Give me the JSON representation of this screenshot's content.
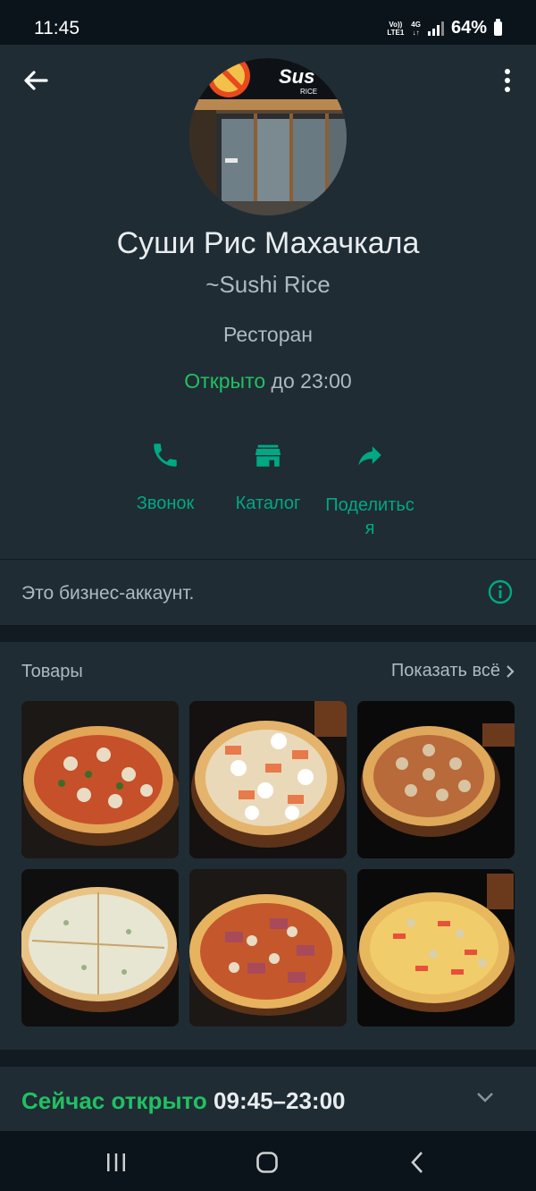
{
  "status_bar": {
    "time": "11:45",
    "volte": "Vo))",
    "lte": "LTE1",
    "net": "4G",
    "battery": "64%"
  },
  "profile": {
    "name": "Суши Рис Махачкала",
    "pushname": "~Sushi Rice",
    "category": "Ресторан",
    "open_label": "Открыто",
    "open_until": "до 23:00",
    "avatar_sign_text": "Sus",
    "avatar_sign_sub": "RICE"
  },
  "actions": {
    "call": "Звонок",
    "catalog": "Каталог",
    "share": "Поделитьс\nя"
  },
  "business": {
    "text": "Это бизнес-аккаунт."
  },
  "products": {
    "title": "Товары",
    "show_all": "Показать всё"
  },
  "hours": {
    "status": "Сейчас открыто",
    "range": "09:45–23:00"
  },
  "colors": {
    "accent": "#00a884",
    "open_green": "#21c063",
    "panel": "#1f2c34",
    "background": "#121b22"
  }
}
